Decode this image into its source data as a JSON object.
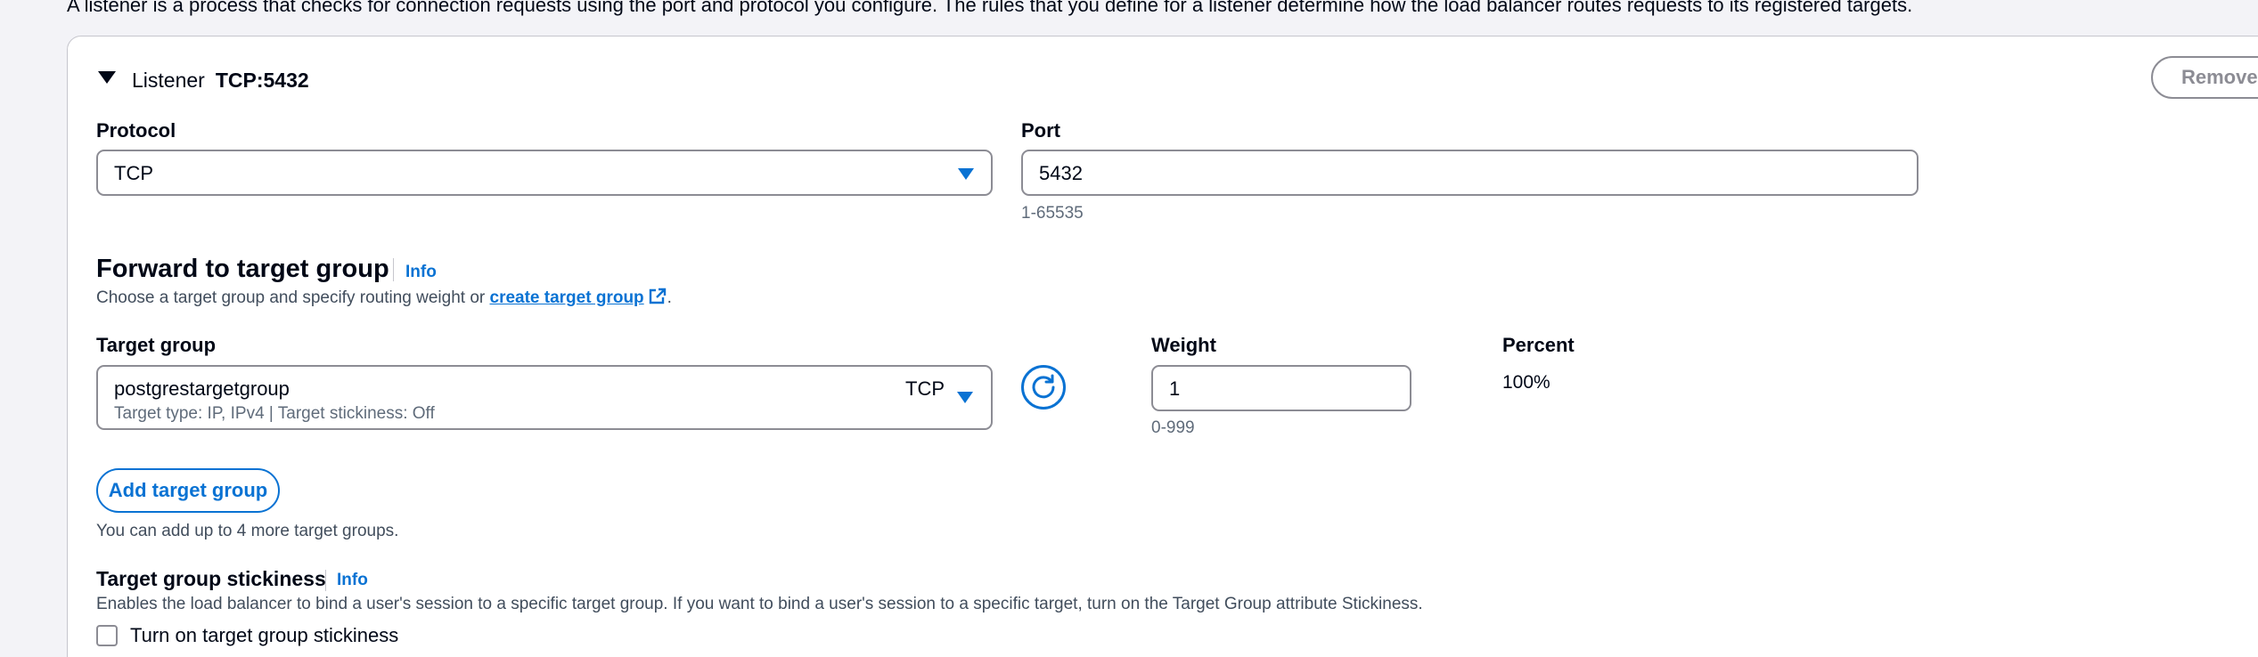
{
  "intro": {
    "text": "A listener is a process that checks for connection requests using the port and protocol you configure. The rules that you define for a listener determine how the load balancer routes requests to its registered targets."
  },
  "listener": {
    "header_label": "Listener",
    "header_value": "TCP:5432",
    "remove_label": "Remove"
  },
  "protocol": {
    "label": "Protocol",
    "value": "TCP"
  },
  "port": {
    "label": "Port",
    "value": "5432",
    "hint": "1-65535"
  },
  "forward": {
    "title": "Forward to target group",
    "info": "Info",
    "description_prefix": "Choose a target group and specify routing weight or ",
    "link": "create target group",
    "description_suffix": "."
  },
  "target_group": {
    "label": "Target group",
    "name": "postgrestargetgroup",
    "protocol": "TCP",
    "details": "Target type: IP, IPv4 | Target stickiness: Off"
  },
  "weight": {
    "label": "Weight",
    "value": "1",
    "hint": "0-999"
  },
  "percent": {
    "label": "Percent",
    "value": "100%"
  },
  "add_target_group": {
    "label": "Add target group",
    "hint": "You can add up to 4 more target groups."
  },
  "stickiness": {
    "title": "Target group stickiness",
    "info": "Info",
    "description": "Enables the load balancer to bind a user's session to a specific target group. If you want to bind a user's session to a specific target, turn on the Target Group attribute Stickiness.",
    "checkbox_label": "Turn on target group stickiness",
    "checked": false
  },
  "colors": {
    "accent": "#0972d3",
    "text": "#000716",
    "muted": "#5f6b7a",
    "border": "#8c8c94"
  }
}
